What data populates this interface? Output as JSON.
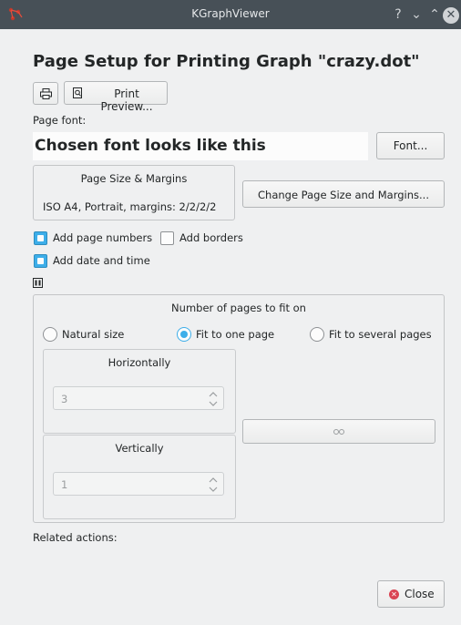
{
  "window": {
    "title": "KGraphViewer",
    "help_glyph": "?",
    "minimize_glyph": "⌄",
    "maximize_glyph": "⌃",
    "close_glyph": "✕"
  },
  "dialog": {
    "heading": "Page Setup for Printing Graph \"crazy.dot\"",
    "print_button_icon": "printer-icon",
    "print_preview_label": "Print Preview...",
    "page_font_label": "Page font:",
    "font_sample": "Chosen font looks like this",
    "font_button_label": "Font...",
    "page_size_group_title": "Page Size & Margins",
    "page_size_value": "ISO A4, Portrait, margins: 2/2/2/2",
    "change_page_size_label": "Change Page Size and Margins...",
    "add_page_numbers_label": "Add page numbers",
    "add_page_numbers_checked": true,
    "add_borders_label": "Add borders",
    "add_borders_checked": false,
    "add_date_time_label": "Add date and time",
    "add_date_time_checked": true,
    "fit_group_title": "Number of pages to fit on",
    "radio_natural_label": "Natural size",
    "radio_fit_one_label": "Fit to one page",
    "radio_fit_several_label": "Fit to several pages",
    "selected_radio": "Fit to one page",
    "horizontally_label": "Horizontally",
    "horizontal_value": "3",
    "vertically_label": "Vertically",
    "vertical_value": "1",
    "related_actions_label": "Related actions:",
    "close_button_label": "Close"
  },
  "colors": {
    "accent": "#3daee9",
    "titlebar": "#475057",
    "window_bg": "#eff0f1",
    "close_icon": "#da4453"
  }
}
